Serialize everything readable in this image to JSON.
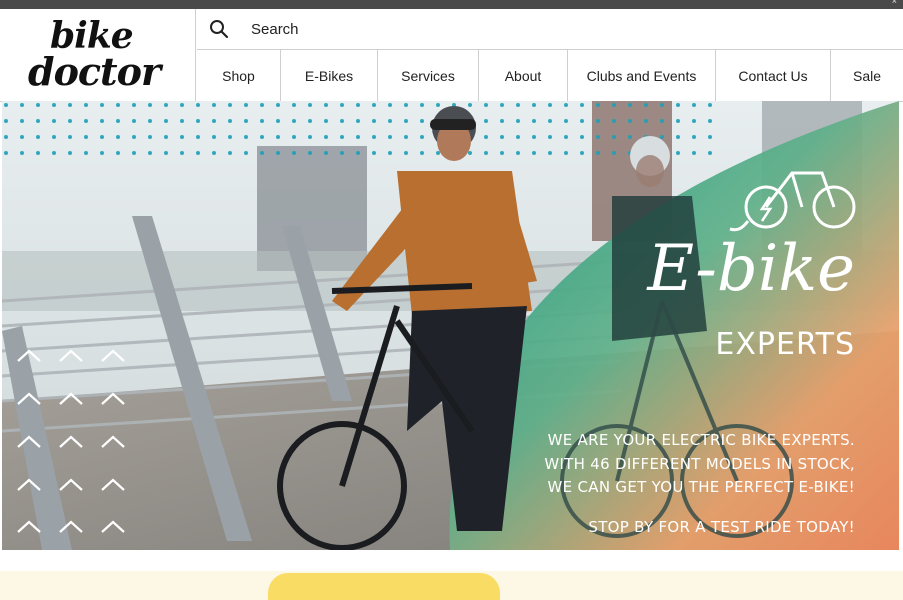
{
  "topbar": {
    "close_glyph": "×"
  },
  "brand": {
    "line1": "bike",
    "line2": "doctor"
  },
  "search": {
    "placeholder": "Search",
    "icon": "search-icon"
  },
  "nav": {
    "items": [
      {
        "label": "Shop"
      },
      {
        "label": "E-Bikes"
      },
      {
        "label": "Services"
      },
      {
        "label": "About"
      },
      {
        "label": "Clubs and Events"
      },
      {
        "label": "Contact Us"
      },
      {
        "label": "Sale"
      }
    ]
  },
  "hero": {
    "title": "E-bike",
    "subtitle": "EXPERTS",
    "description_lines": [
      "WE ARE YOUR ELECTRIC BIKE EXPERTS.",
      "WITH 46 DIFFERENT MODELS IN STOCK,",
      "WE CAN GET YOU THE PERFECT E-BIKE!"
    ],
    "cta": "STOP BY FOR A TEST RIDE TODAY!",
    "icon": "electric-bike-icon",
    "colors": {
      "teal": "#1e9a86",
      "orange": "#f0925f",
      "sky": "#dfe7ea",
      "dots": "#1aa0b8"
    }
  }
}
